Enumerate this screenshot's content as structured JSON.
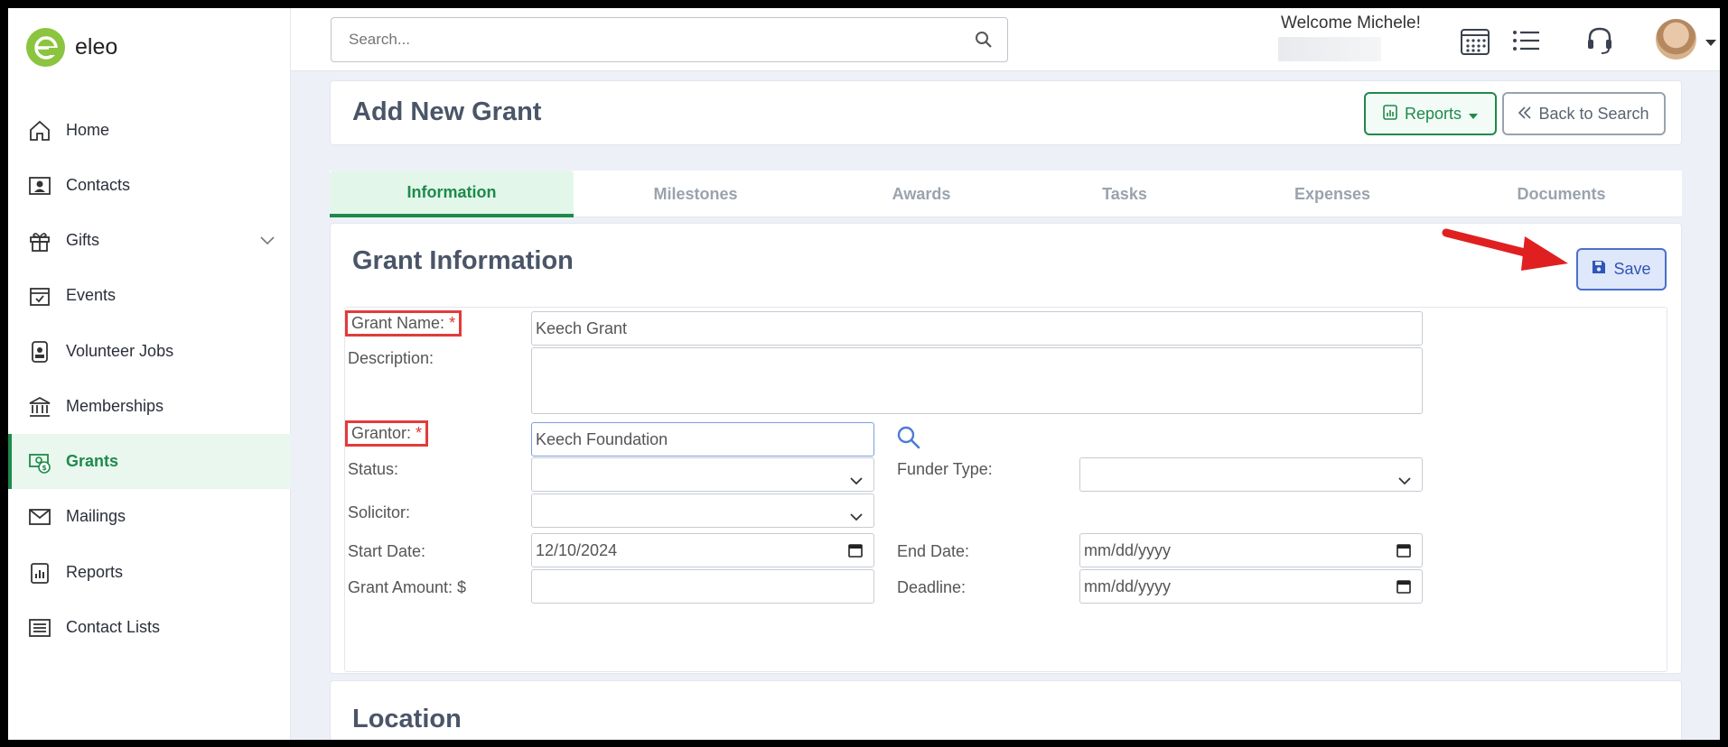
{
  "brand": {
    "name": "eleo",
    "color": "#8bc43f"
  },
  "search": {
    "placeholder": "Search..."
  },
  "user": {
    "welcome": "Welcome Michele!"
  },
  "sidebar": {
    "items": [
      {
        "label": "Home",
        "icon": "home-icon"
      },
      {
        "label": "Contacts",
        "icon": "contact-card-icon"
      },
      {
        "label": "Gifts",
        "icon": "gift-icon"
      },
      {
        "label": "Events",
        "icon": "calendar-check-icon"
      },
      {
        "label": "Volunteer Jobs",
        "icon": "badge-icon"
      },
      {
        "label": "Memberships",
        "icon": "bank-icon"
      },
      {
        "label": "Grants",
        "icon": "grant-icon",
        "active": true
      },
      {
        "label": "Mailings",
        "icon": "envelope-icon"
      },
      {
        "label": "Reports",
        "icon": "report-icon"
      },
      {
        "label": "Contact Lists",
        "icon": "list-icon"
      }
    ]
  },
  "header": {
    "title": "Add New Grant",
    "reports_label": "Reports",
    "back_label": "Back to Search"
  },
  "tabs": [
    {
      "label": "Information",
      "active": true
    },
    {
      "label": "Milestones"
    },
    {
      "label": "Awards"
    },
    {
      "label": "Tasks"
    },
    {
      "label": "Expenses"
    },
    {
      "label": "Documents"
    }
  ],
  "form": {
    "section_title": "Grant Information",
    "save_label": "Save",
    "grant_name_label": "Grant Name:",
    "grant_name_value": "Keech Grant",
    "required_mark": "*",
    "description_label": "Description:",
    "description_value": "",
    "grantor_label": "Grantor:",
    "grantor_value": "Keech Foundation",
    "status_label": "Status:",
    "status_value": "",
    "funder_type_label": "Funder Type:",
    "funder_type_value": "",
    "solicitor_label": "Solicitor:",
    "solicitor_value": "",
    "start_date_label": "Start Date:",
    "start_date_value": "12/10/2024",
    "end_date_label": "End Date:",
    "end_date_value": "mm/dd/yyyy",
    "grant_amount_label": "Grant Amount: $",
    "grant_amount_value": "",
    "deadline_label": "Deadline:",
    "deadline_value": "mm/dd/yyyy"
  },
  "location": {
    "title": "Location"
  },
  "colors": {
    "accent": "#1e8a4a",
    "save": "#2f55b8",
    "annotation": "#e23b3b"
  }
}
